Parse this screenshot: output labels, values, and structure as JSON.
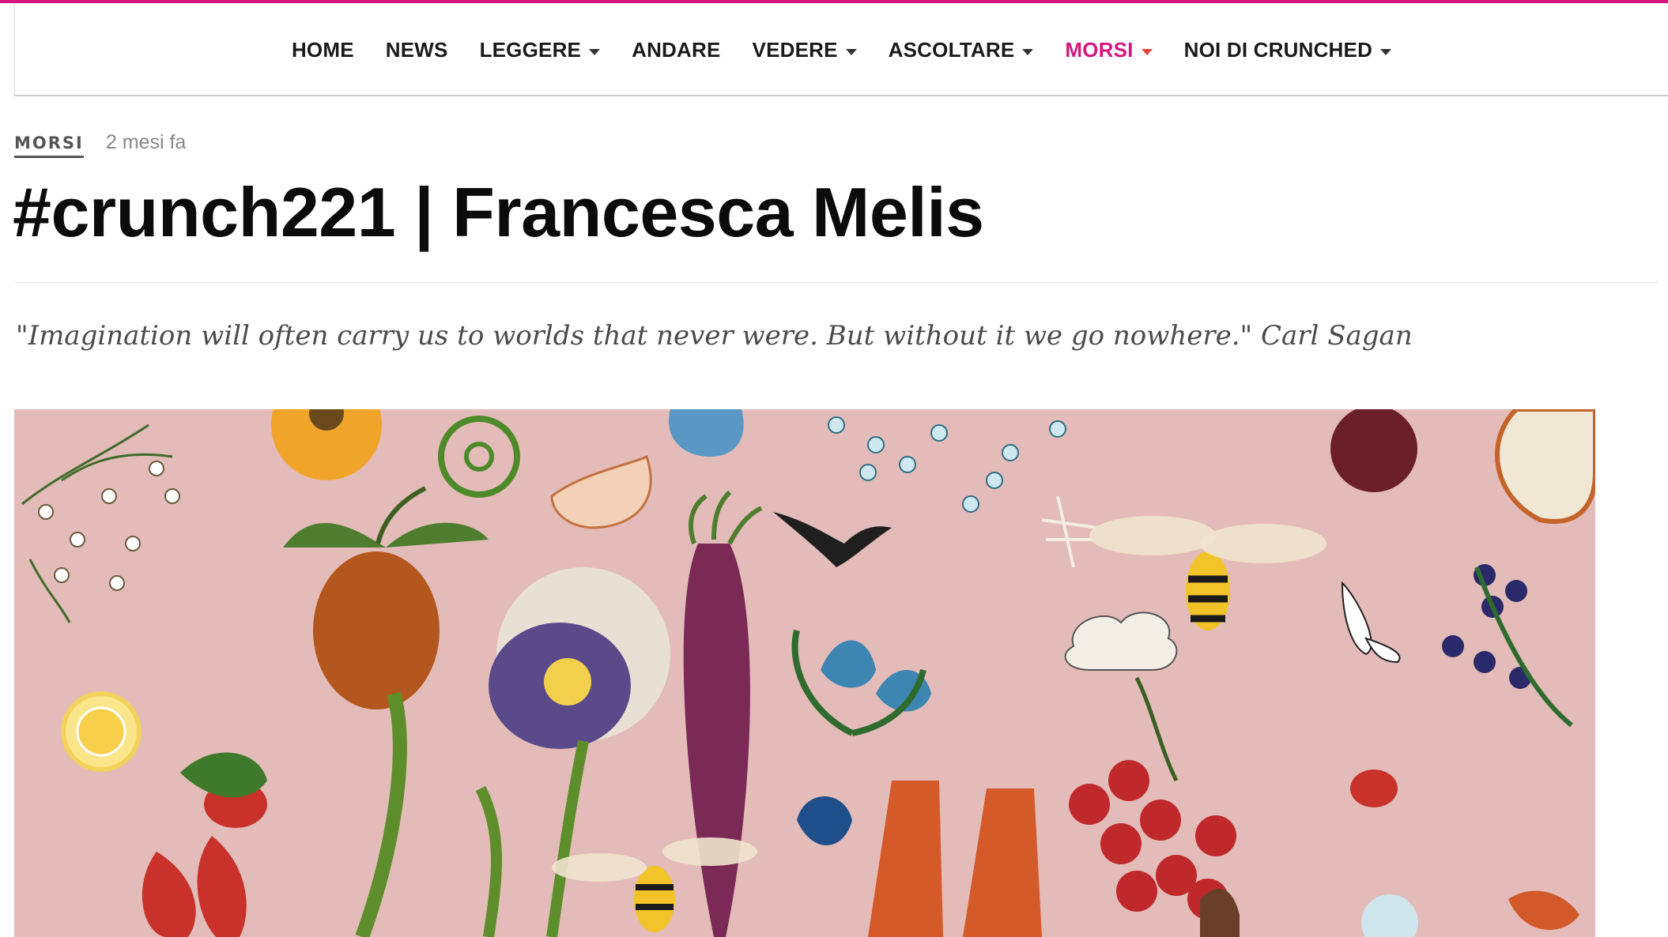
{
  "nav": {
    "items": [
      {
        "label": "HOME",
        "dropdown": false,
        "active": false
      },
      {
        "label": "NEWS",
        "dropdown": false,
        "active": false
      },
      {
        "label": "LEGGERE",
        "dropdown": true,
        "active": false
      },
      {
        "label": "ANDARE",
        "dropdown": false,
        "active": false
      },
      {
        "label": "VEDERE",
        "dropdown": true,
        "active": false
      },
      {
        "label": "ASCOLTARE",
        "dropdown": true,
        "active": false
      },
      {
        "label": "MORSI",
        "dropdown": true,
        "active": true
      },
      {
        "label": "NOI DI CRUNCHED",
        "dropdown": true,
        "active": false
      }
    ]
  },
  "article": {
    "category": "MORSI",
    "time_ago": "2 mesi fa",
    "title": "#crunch221 | Francesca Melis",
    "quote": "\"Imagination will often carry us to worlds that never were. But without it we go nowhere.\" Carl Sagan"
  },
  "colors": {
    "accent": "#d6167e",
    "hero_background": "#e3bbb8"
  }
}
